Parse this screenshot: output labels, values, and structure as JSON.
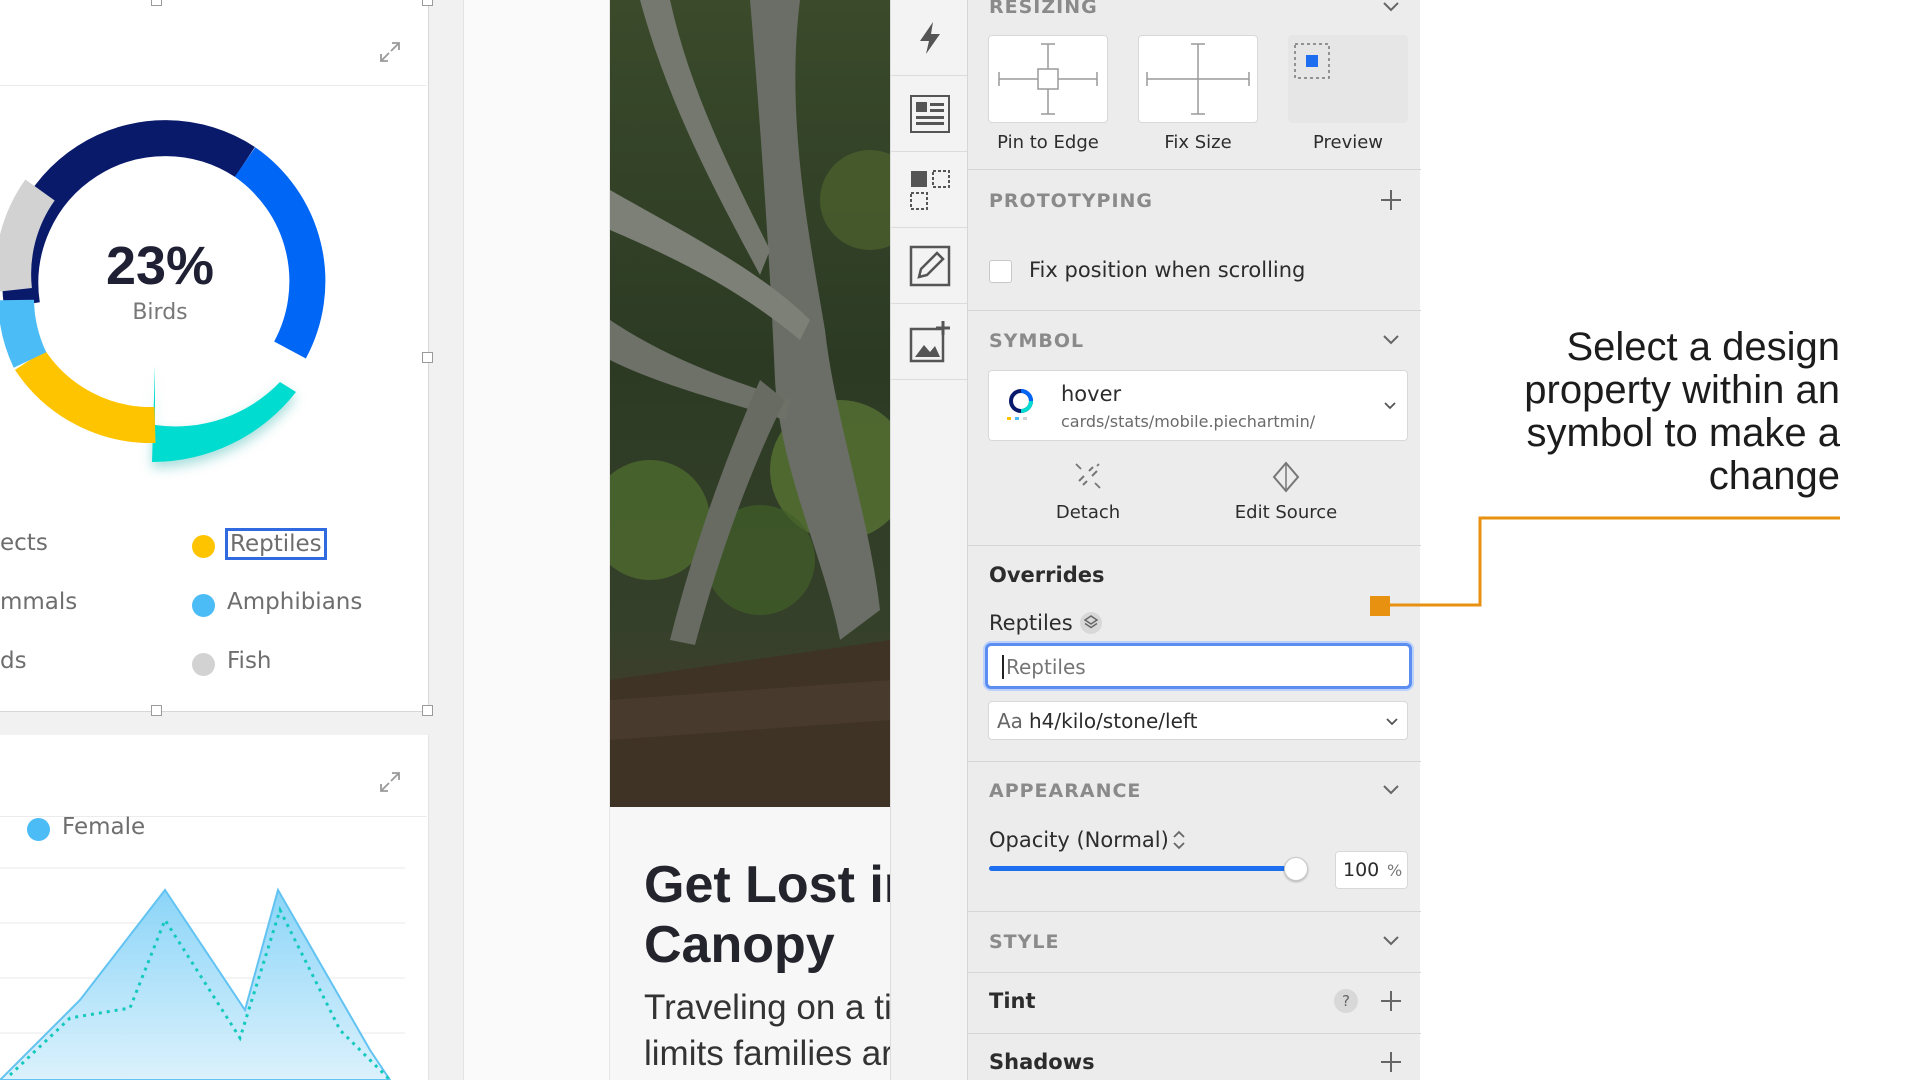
{
  "canvas": {
    "donut_card": {
      "percent": "23%",
      "label": "Birds",
      "legend": [
        {
          "name": "ects",
          "color": ""
        },
        {
          "name": "Reptiles",
          "color": "#ffc400"
        },
        {
          "name": "mmals",
          "color": ""
        },
        {
          "name": "Amphibians",
          "color": "#4bbcf6"
        },
        {
          "name": "ds",
          "color": ""
        },
        {
          "name": "Fish",
          "color": "#d2d2d2"
        }
      ],
      "colors": {
        "navy": "#0a1a6b",
        "blue": "#0066f5",
        "teal": "#00dccf",
        "yellow": "#ffc400",
        "sky": "#4bbcf6",
        "gray": "#d2d2d2"
      }
    },
    "area_card": {
      "legend_label": "Female",
      "legend_color": "#4bbcf6"
    }
  },
  "article": {
    "headline_line1": "Get Lost ir",
    "headline_line2": "Canopy",
    "body_line1": "Traveling on a ti(",
    "body_line2": "limits families ar"
  },
  "toolbar": {
    "tools": [
      "lightning-icon",
      "text-list-icon",
      "symbol-grid-icon",
      "edit-image-icon",
      "add-image-icon"
    ]
  },
  "inspector": {
    "resizing": {
      "title": "RESIZING",
      "options": [
        "Pin to Edge",
        "Fix Size",
        "Preview"
      ]
    },
    "prototyping": {
      "title": "PROTOTYPING",
      "fix_position_label": "Fix position when scrolling"
    },
    "symbol": {
      "title": "SYMBOL",
      "name": "hover",
      "path": "cards/stats/mobile.piechartmin/",
      "detach_label": "Detach",
      "edit_source_label": "Edit Source"
    },
    "overrides": {
      "title": "Overrides",
      "field_label": "Reptiles",
      "field_placeholder": "Reptiles",
      "text_style_prefix": "Aa",
      "text_style": "h4/kilo/stone/left"
    },
    "appearance": {
      "title": "APPEARANCE",
      "opacity_label": "Opacity (Normal)",
      "opacity_value": "100",
      "opacity_unit": "%",
      "opacity_fraction": 1.0
    },
    "style": {
      "title": "STYLE",
      "tint_label": "Tint",
      "tint_help": "?",
      "shadows_label": "Shadows"
    }
  },
  "annotation": {
    "line1": "Select a design",
    "line2": "property within an",
    "line3": "symbol to make a",
    "line4": "change",
    "color": "#e8900f"
  }
}
